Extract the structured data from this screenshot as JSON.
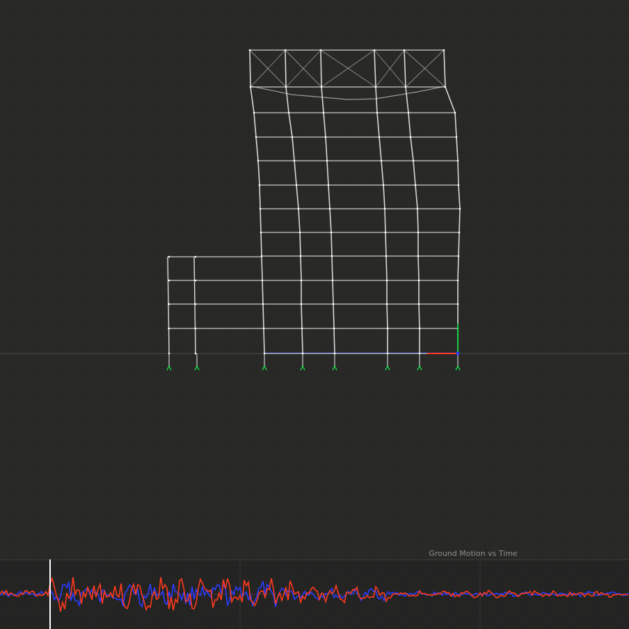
{
  "plot": {
    "title": "Ground Motion vs Time",
    "series_colors": [
      "#2b3cff",
      "#ff3a1e"
    ]
  },
  "colors": {
    "background": "#262624",
    "frame": "#e8e8e8",
    "support": "#19d14a",
    "ground_line": "#4a4a4a",
    "axis_x": "#ff3a1e",
    "axis_y": "#19d14a",
    "axis_z": "#2b3cff",
    "time_cursor": "#ffffff"
  },
  "icons": {
    "support": "pin-support-icon",
    "axes": "xyz-axes-gizmo-icon"
  }
}
